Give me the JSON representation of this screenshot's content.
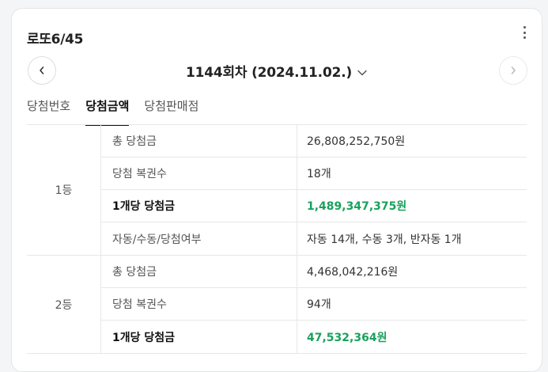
{
  "widget": {
    "title": "로또6/45",
    "round_label": "1144회차 (2024.11.02.)"
  },
  "tabs": [
    {
      "label": "당첨번호"
    },
    {
      "label": "당첨금액"
    },
    {
      "label": "당첨판매점"
    }
  ],
  "ranks": [
    {
      "rank": "1등",
      "rows": [
        {
          "label": "총 당첨금",
          "value": "26,808,252,750원"
        },
        {
          "label": "당첨 복권수",
          "value": "18개"
        },
        {
          "label": "1개당 당첨금",
          "value": "1,489,347,375원"
        },
        {
          "label": "자동/수동/당첨여부",
          "value": "자동 14개, 수동 3개, 반자동 1개"
        }
      ]
    },
    {
      "rank": "2등",
      "rows": [
        {
          "label": "총 당첨금",
          "value": "4,468,042,216원"
        },
        {
          "label": "당첨 복권수",
          "value": "94개"
        },
        {
          "label": "1개당 당첨금",
          "value": "47,532,364원"
        }
      ]
    }
  ],
  "colors": {
    "accent_green": "#1aa15c",
    "active_tab_underline": "#111111"
  },
  "icons": {
    "prev": "chevron-left-icon",
    "next": "chevron-right-icon",
    "dropdown": "chevron-down-icon",
    "more": "more-vertical-icon"
  }
}
